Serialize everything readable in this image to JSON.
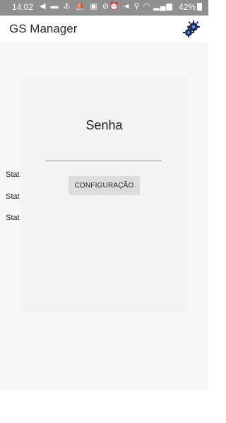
{
  "status_bar": {
    "time": "14:02",
    "left_icons": "◀ ▬ ⚓ ⛵ ▣ ⊘ ···",
    "right_icons": "⏰ ◄ ⚲ ◠ ▂▄▆",
    "battery_text": "42%"
  },
  "app": {
    "title": "GS Manager",
    "settings_icon": "gears-icon"
  },
  "content": {
    "stat_labels": [
      "Stat",
      "Stat",
      "Stat"
    ],
    "spinner_color": "#2d3ea8"
  },
  "dialog": {
    "title": "Senha",
    "password_value": "",
    "button_label": "CONFIGURAÇÃO"
  }
}
